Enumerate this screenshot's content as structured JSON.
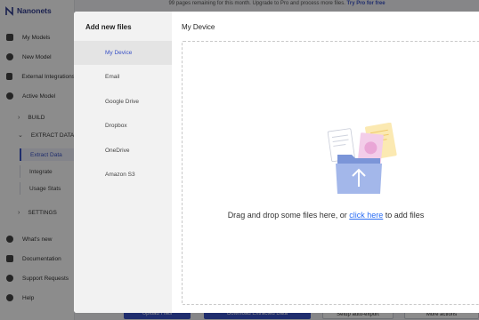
{
  "app": {
    "brand": "Nanonets",
    "banner_text": "99 pages remaining for this month. Upgrade to Pro and process more files.",
    "banner_link": "Try Pro for free"
  },
  "sidebar": {
    "items": [
      {
        "label": "My Models",
        "icon": "home-icon"
      },
      {
        "label": "New Model",
        "icon": "plus-circle-icon"
      },
      {
        "label": "External Integrations",
        "icon": "integrations-icon"
      },
      {
        "label": "Active Model",
        "icon": "compass-icon"
      }
    ],
    "sections": {
      "build": "BUILD",
      "extract": "EXTRACT DATA",
      "settings": "SETTINGS"
    },
    "children": [
      "Extract Data",
      "Integrate",
      "Usage Stats"
    ],
    "footer_items": [
      {
        "label": "What's new",
        "icon": "bell-icon"
      },
      {
        "label": "Documentation",
        "icon": "book-icon"
      },
      {
        "label": "Support Requests",
        "icon": "support-icon"
      },
      {
        "label": "Help",
        "icon": "help-icon"
      }
    ]
  },
  "bottom_bar": {
    "upload": "Upload Files",
    "download": "Download Extracted Data",
    "export": "Setup auto-export",
    "more": "More actions"
  },
  "modal": {
    "side_title": "Add new files",
    "sources": [
      "My Device",
      "Email",
      "Google Drive",
      "Dropbox",
      "OneDrive",
      "Amazon S3"
    ],
    "selected_source": "My Device",
    "main_title": "My Device",
    "drop_text_before": "Drag and drop some files here, or ",
    "drop_link": "click here",
    "drop_text_after": " to add files"
  },
  "colors": {
    "accent": "#3a52c6",
    "link": "#2a6df4",
    "modal_side_bg": "#f2f2f2",
    "folder": "#8aa4e0"
  }
}
